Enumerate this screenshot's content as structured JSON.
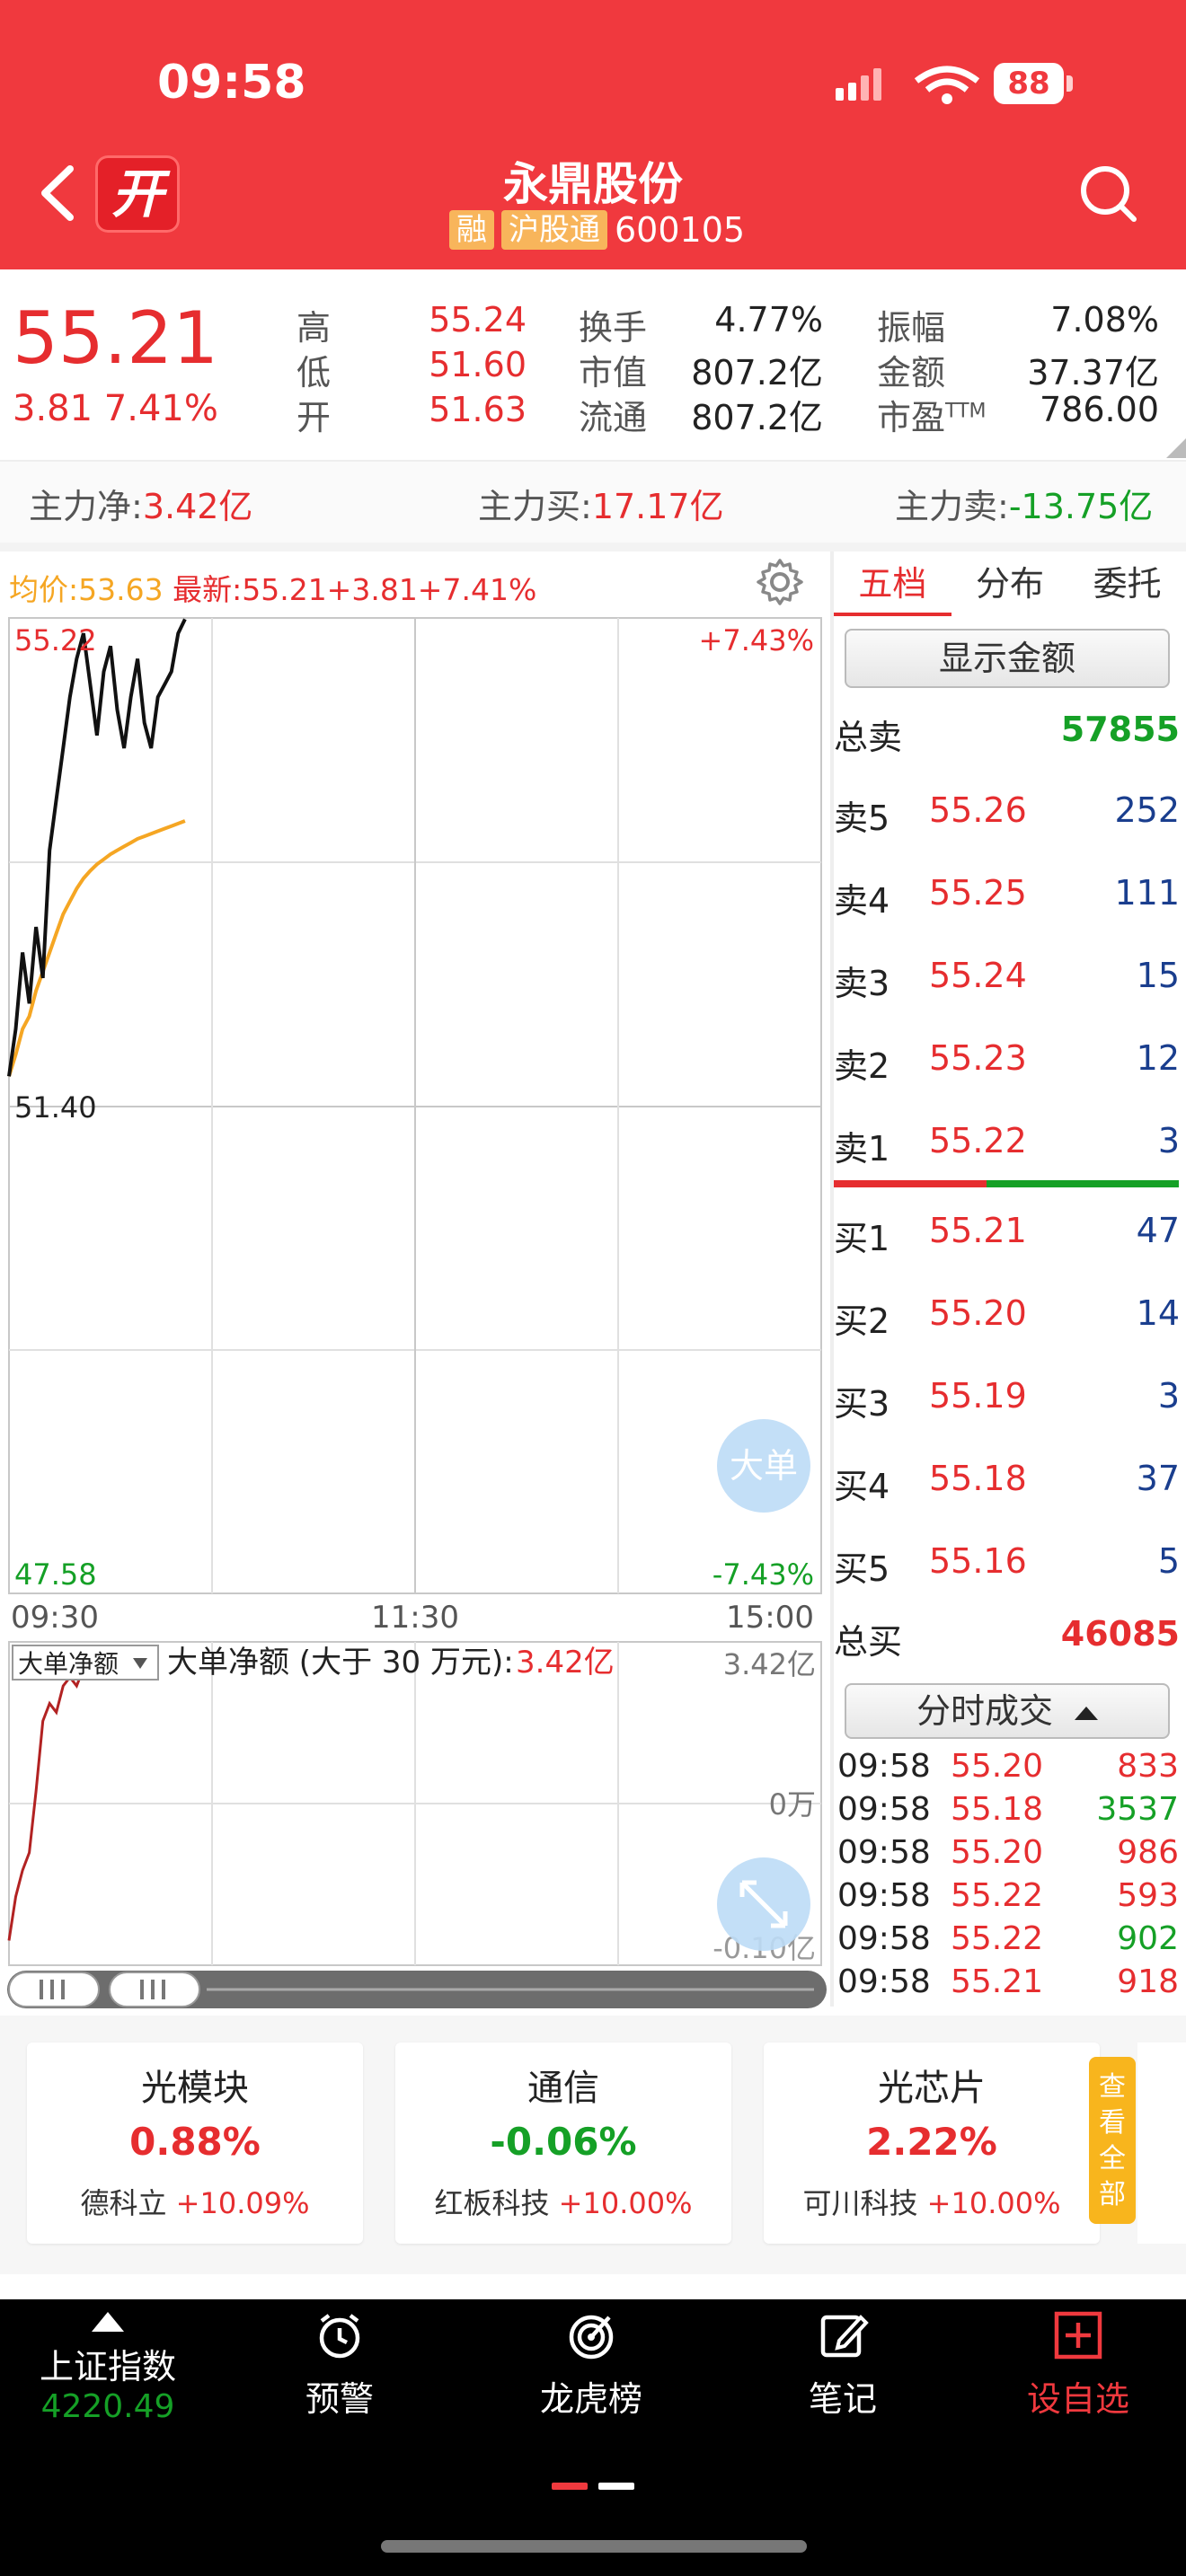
{
  "status_bar": {
    "time": "09:58",
    "battery": "88"
  },
  "header": {
    "badge": "开",
    "stock_name": "永鼎股份",
    "tags": [
      "融",
      "沪股通"
    ],
    "stock_code": "600105"
  },
  "quote": {
    "price": "55.21",
    "change": "3.81 7.41%",
    "rows": [
      {
        "label": "高",
        "value": "55.24",
        "label2": "换手",
        "value2": "4.77%",
        "label3": "振幅",
        "value3": "7.08%"
      },
      {
        "label": "低",
        "value": "51.60",
        "label2": "市值",
        "value2": "807.2亿",
        "label3": "金额",
        "value3": "37.37亿"
      },
      {
        "label": "开",
        "value": "51.63",
        "label2": "流通",
        "value2": "807.2亿",
        "label3": "市盈",
        "label3_sup": "TTM",
        "value3": "786.00"
      }
    ]
  },
  "capital": {
    "net_label": "主力净:",
    "net_value": "3.42亿",
    "buy_label": "主力买:",
    "buy_value": "17.17亿",
    "sell_label": "主力卖:",
    "sell_value": "-13.75亿"
  },
  "chart_header": {
    "avg_label": "均价:53.63",
    "latest_label": "最新:55.21+3.81+7.41%"
  },
  "chart_data": [
    {
      "type": "line",
      "title": "",
      "y_labels": {
        "top": "55.22",
        "mid": "51.40",
        "bottom": "47.58",
        "top_pct": "+7.43%",
        "bottom_pct": "-7.43%"
      },
      "x_labels": [
        "09:30",
        "11:30",
        "15:00"
      ],
      "ylim": [
        47.58,
        55.22
      ],
      "x": [
        0,
        2,
        4,
        6,
        8,
        10,
        12,
        14,
        16,
        18,
        20,
        22,
        24,
        26,
        28,
        30,
        32,
        34,
        36,
        38,
        40,
        42,
        44,
        46,
        48,
        50,
        52
      ],
      "series": [
        {
          "values": [
            51.63,
            52.0,
            52.6,
            52.2,
            52.8,
            52.4,
            53.4,
            53.8,
            54.2,
            54.6,
            54.9,
            55.1,
            54.7,
            54.3,
            54.8,
            55.0,
            54.5,
            54.2,
            54.6,
            54.9,
            54.4,
            54.2,
            54.6,
            54.7,
            54.8,
            55.1,
            55.21
          ]
        },
        {
          "values": [
            51.63,
            51.8,
            52.0,
            52.1,
            52.3,
            52.45,
            52.6,
            52.75,
            52.9,
            53.0,
            53.1,
            53.18,
            53.24,
            53.29,
            53.33,
            53.37,
            53.4,
            53.43,
            53.46,
            53.49,
            53.51,
            53.53,
            53.55,
            53.57,
            53.59,
            53.61,
            53.63
          ]
        }
      ],
      "color_price": "#111111",
      "color_avg": "#f5a623",
      "big_order_label": "大单"
    },
    {
      "type": "line",
      "title": "大单净额 (大于 30 万元):",
      "value": "3.42亿",
      "selector": "大单净额",
      "y_labels": {
        "top": "3.42亿",
        "mid": "0万",
        "bottom": "-0.10亿"
      },
      "ylim": [
        -0.1,
        3.42
      ],
      "x": [
        0,
        2,
        4,
        6,
        8,
        10,
        12,
        14,
        16,
        18,
        20,
        22,
        24,
        26
      ],
      "series": [
        {
          "values": [
            0.1,
            0.6,
            0.9,
            1.1,
            1.8,
            2.6,
            2.8,
            2.7,
            3.0,
            3.1,
            3.0,
            3.2,
            3.3,
            3.42
          ]
        }
      ],
      "color": "#b22222"
    }
  ],
  "side": {
    "tabs": [
      "五档",
      "分布",
      "委托"
    ],
    "show_amount": "显示金额",
    "total_sell_label": "总卖",
    "total_sell": "57855",
    "total_buy_label": "总买",
    "total_buy": "46085",
    "asks": [
      {
        "label": "卖5",
        "price": "55.26",
        "vol": "252"
      },
      {
        "label": "卖4",
        "price": "55.25",
        "vol": "111"
      },
      {
        "label": "卖3",
        "price": "55.24",
        "vol": "15"
      },
      {
        "label": "卖2",
        "price": "55.23",
        "vol": "12"
      },
      {
        "label": "卖1",
        "price": "55.22",
        "vol": "3"
      }
    ],
    "bids": [
      {
        "label": "买1",
        "price": "55.21",
        "vol": "47"
      },
      {
        "label": "买2",
        "price": "55.20",
        "vol": "14"
      },
      {
        "label": "买3",
        "price": "55.19",
        "vol": "3"
      },
      {
        "label": "买4",
        "price": "55.18",
        "vol": "37"
      },
      {
        "label": "买5",
        "price": "55.16",
        "vol": "5"
      }
    ],
    "ticks_label": "分时成交",
    "ticks": [
      {
        "time": "09:58",
        "price": "55.20",
        "vol": "833",
        "vol_color": "#e62d2f"
      },
      {
        "time": "09:58",
        "price": "55.18",
        "vol": "3537",
        "vol_color": "#15a026"
      },
      {
        "time": "09:58",
        "price": "55.20",
        "vol": "986",
        "vol_color": "#e62d2f"
      },
      {
        "time": "09:58",
        "price": "55.22",
        "vol": "593",
        "vol_color": "#e62d2f"
      },
      {
        "time": "09:58",
        "price": "55.22",
        "vol": "902",
        "vol_color": "#15a026"
      },
      {
        "time": "09:58",
        "price": "55.21",
        "vol": "918",
        "vol_color": "#e62d2f"
      }
    ]
  },
  "sectors": [
    {
      "name": "光模块",
      "pct": "0.88%",
      "leader": "德科立",
      "leader_pct": "+10.09%",
      "pct_color": "#e62d2f"
    },
    {
      "name": "通信",
      "pct": "-0.06%",
      "leader": "红板科技",
      "leader_pct": "+10.00%",
      "pct_color": "#15a026"
    },
    {
      "name": "光芯片",
      "pct": "2.22%",
      "leader": "可川科技",
      "leader_pct": "+10.00%",
      "pct_color": "#e62d2f"
    }
  ],
  "view_all": "查看全部",
  "bottom_nav": {
    "index_name": "上证指数",
    "index_value": "4220.49",
    "items": [
      {
        "label": "预警",
        "icon": "alarm-clock-icon"
      },
      {
        "label": "龙虎榜",
        "icon": "target-icon"
      },
      {
        "label": "笔记",
        "icon": "edit-note-icon"
      },
      {
        "label": "设自选",
        "icon": "add-watchlist-icon"
      }
    ]
  },
  "colors": {
    "brand_red": "#f0393e",
    "up": "#e62d2f",
    "down": "#15a026",
    "accent": "#f8b55b"
  }
}
